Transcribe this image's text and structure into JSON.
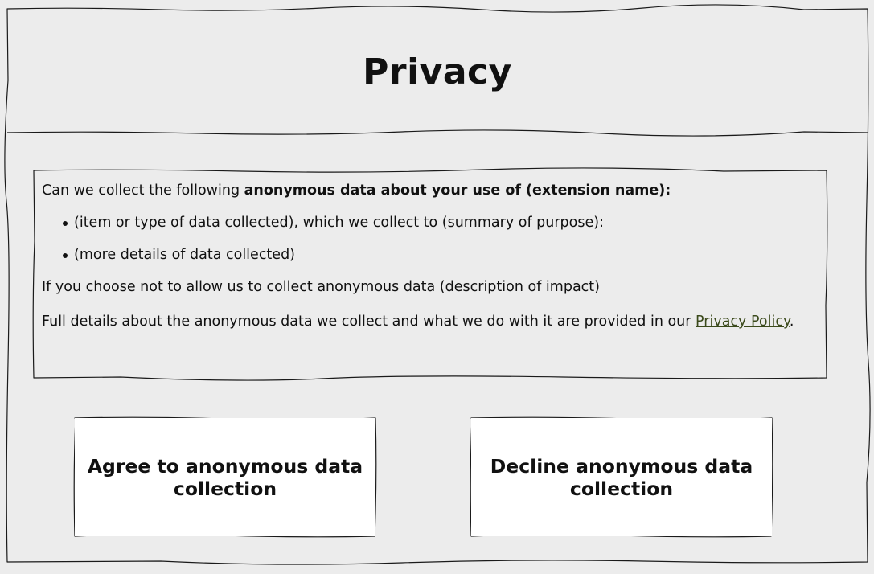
{
  "header": {
    "title": "Privacy"
  },
  "info": {
    "intro_plain": "Can we collect the following ",
    "intro_bold": "anonymous data about your use of (extension name):",
    "bullets": [
      "(item or type of data collected), which we collect to (summary of purpose):",
      "(more details of data collected)"
    ],
    "impact": "If you choose not to allow us to collect anonymous data (description of impact)",
    "details_prefix": "Full details about the anonymous data we collect and what we do with it are provided in our ",
    "privacy_link": "Privacy Policy",
    "details_suffix": "."
  },
  "buttons": {
    "agree_label": "Agree to anonymous data collection",
    "decline_label": "Decline anonymous data collection"
  },
  "colors": {
    "background": "#ececec",
    "stroke": "#1a1a1a",
    "button_fill": "#ffffff",
    "link": "#3b4a1c"
  }
}
